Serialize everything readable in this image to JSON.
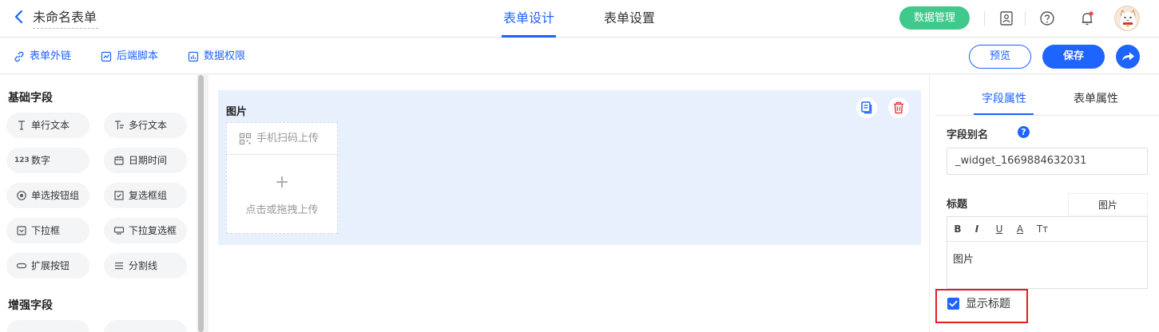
{
  "header": {
    "form_name": "未命名表单",
    "tabs": [
      {
        "label": "表单设计",
        "active": true
      },
      {
        "label": "表单设置",
        "active": false
      }
    ],
    "data_button": "数据管理",
    "accent_color": "#1e64ff",
    "data_button_color": "#3fc98b"
  },
  "toolbar": {
    "links": [
      {
        "label": "表单外链",
        "icon": "link-icon"
      },
      {
        "label": "后端脚本",
        "icon": "script-icon"
      },
      {
        "label": "数据权限",
        "icon": "chart-icon"
      }
    ],
    "preview_label": "预览",
    "save_label": "保存"
  },
  "left_panel": {
    "groups": [
      {
        "title": "基础字段",
        "fields": [
          {
            "label": "单行文本",
            "icon": "text-cursor-icon"
          },
          {
            "label": "多行文本",
            "icon": "multiline-text-icon"
          },
          {
            "label": "数字",
            "icon": "number-icon",
            "icon_text": "123"
          },
          {
            "label": "日期时间",
            "icon": "calendar-icon"
          },
          {
            "label": "单选按钮组",
            "icon": "radio-icon"
          },
          {
            "label": "复选框组",
            "icon": "checkbox-group-icon"
          },
          {
            "label": "下拉框",
            "icon": "dropdown-icon"
          },
          {
            "label": "下拉复选框",
            "icon": "dropdown-multi-icon"
          },
          {
            "label": "扩展按钮",
            "icon": "extend-button-icon"
          },
          {
            "label": "分割线",
            "icon": "divider-icon"
          }
        ]
      },
      {
        "title": "增强字段",
        "fields": []
      }
    ]
  },
  "canvas": {
    "widget_title": "图片",
    "scan_upload": "手机扫码上传",
    "plus_glyph": "+",
    "drop_upload": "点击或拖拽上传"
  },
  "right_panel": {
    "tabs": [
      {
        "label": "字段属性",
        "active": true
      },
      {
        "label": "表单属性",
        "active": false
      }
    ],
    "alias_label": "字段别名",
    "alias_value": "_widget_1669884632031",
    "title_label": "标题",
    "title_tag": "图片",
    "editor_buttons": [
      "B",
      "I",
      "U",
      "A",
      "Tт"
    ],
    "editor_content": "图片",
    "show_title_label": "显示标题",
    "show_title_checked": true,
    "highlight_color": "#e51c23"
  }
}
